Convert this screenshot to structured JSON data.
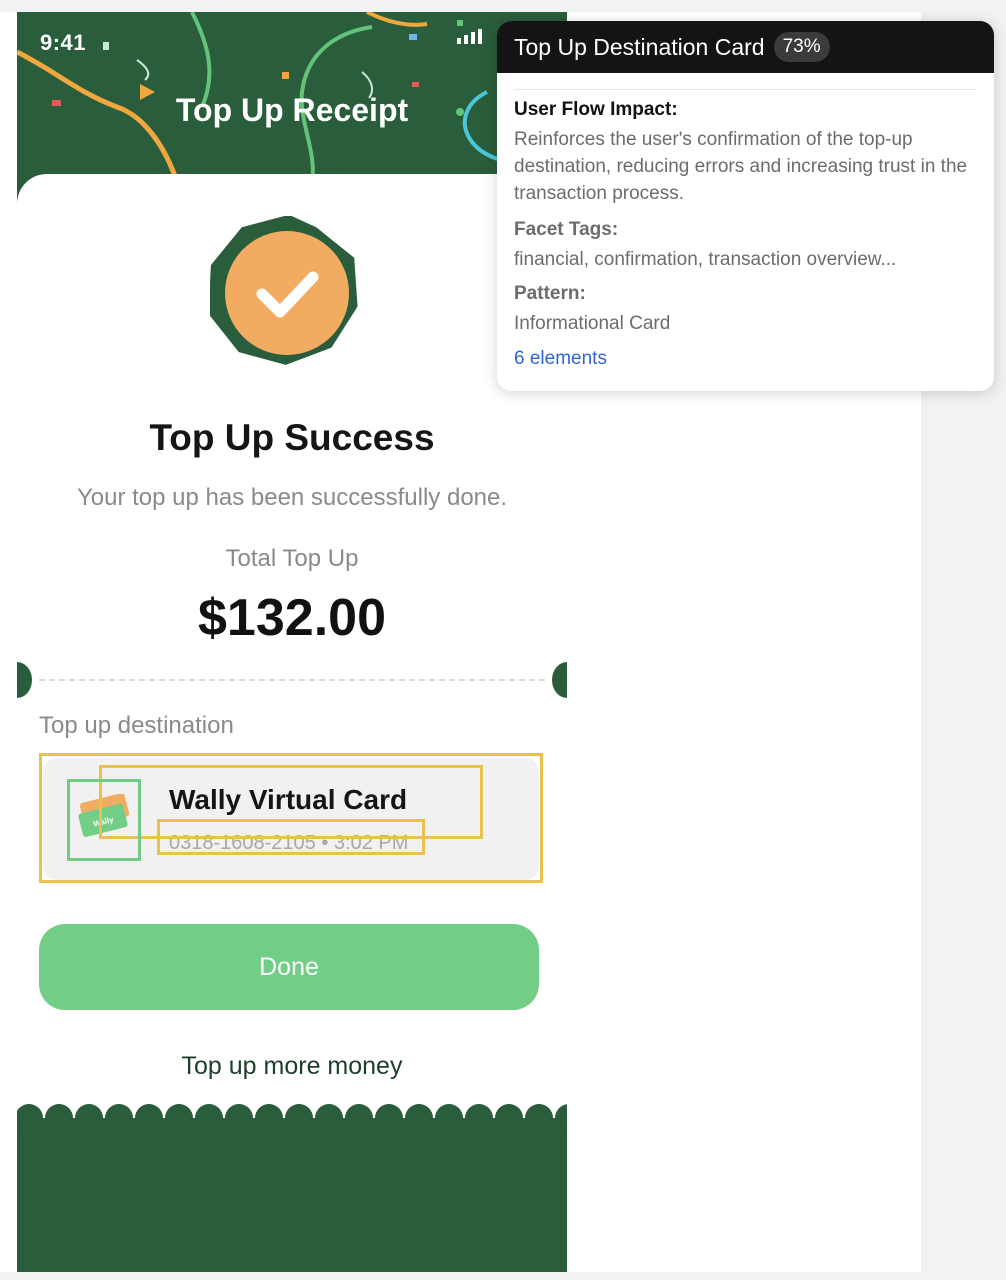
{
  "phone": {
    "status_time": "9:41",
    "screen_title": "Top Up Receipt",
    "success_title": "Top Up Success",
    "success_description": "Your top up has been successfully done.",
    "total_label": "Total Top Up",
    "total_amount": "$132.00",
    "destination_label": "Top up destination",
    "destination_card": {
      "name": "Wally Virtual Card",
      "meta": "0318-1608-2105  •  3:02 PM",
      "logo_text": "Wally"
    },
    "done_label": "Done",
    "more_label": "Top up more money"
  },
  "popup": {
    "title": "Top Up Destination Card",
    "confidence": "73%",
    "impact_heading": "User Flow Impact:",
    "impact_text": "Reinforces the user's confirmation of the top-up destination, reducing errors and increasing trust in the transaction process.",
    "tags_heading": "Facet Tags:",
    "tags_text": "financial, confirmation, transaction overview...",
    "pattern_heading": "Pattern:",
    "pattern_text": "Informational Card",
    "elements_link": "6 elements"
  },
  "colors": {
    "header_green": "#2a5d3b",
    "accent_orange": "#f2ac62",
    "button_green": "#72cd86",
    "highlight_yellow": "#e8c14e",
    "highlight_green": "#73cc86",
    "link_blue": "#2f66d6"
  },
  "icons": [
    "signal-icon",
    "battery-icon",
    "check-badge-icon",
    "wally-card-icon"
  ]
}
